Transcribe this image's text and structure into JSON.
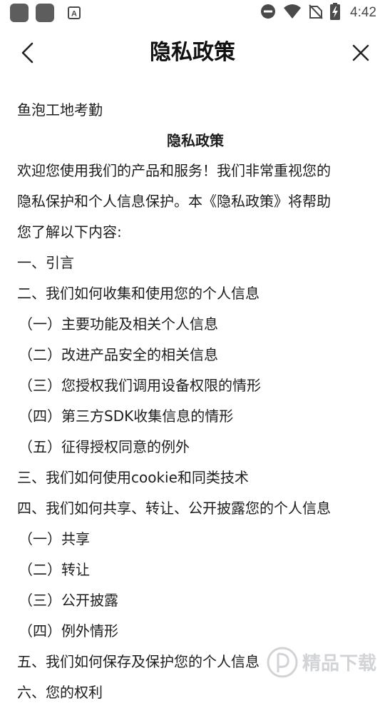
{
  "status_bar": {
    "time": "4:42",
    "icons": [
      "app-icon",
      "app-icon",
      "a-notification-icon",
      "do-not-disturb-icon",
      "wifi-icon",
      "no-sim-icon",
      "battery-charging-icon"
    ]
  },
  "header": {
    "title": "隐私政策",
    "back_icon": "chevron-left-icon",
    "close_icon": "close-icon"
  },
  "content": {
    "lines": [
      "鱼泡工地考勤",
      "隐私政策",
      "欢迎您使用我们的产品和服务！我们非常重视您的",
      "隐私保护和个人信息保护。本《隐私政策》将帮助",
      "您了解以下内容:",
      "一、引言",
      "二、我们如何收集和使用您的个人信息",
      "（一）主要功能及相关个人信息",
      "（二）改进产品安全的相关信息",
      "（三）您授权我们调用设备权限的情形",
      "（四）第三方SDK收集信息的情形",
      "（五）征得授权同意的例外",
      "三、我们如何使用cookie和同类技术",
      "四、我们如何共享、转让、公开披露您的个人信息",
      "（一）共享",
      "（二）转让",
      "（三）公开披露",
      "（四）例外情形",
      "五、我们如何保存及保护您的个人信息",
      "六、您的权利"
    ]
  },
  "watermark": {
    "text": "精品下载"
  }
}
